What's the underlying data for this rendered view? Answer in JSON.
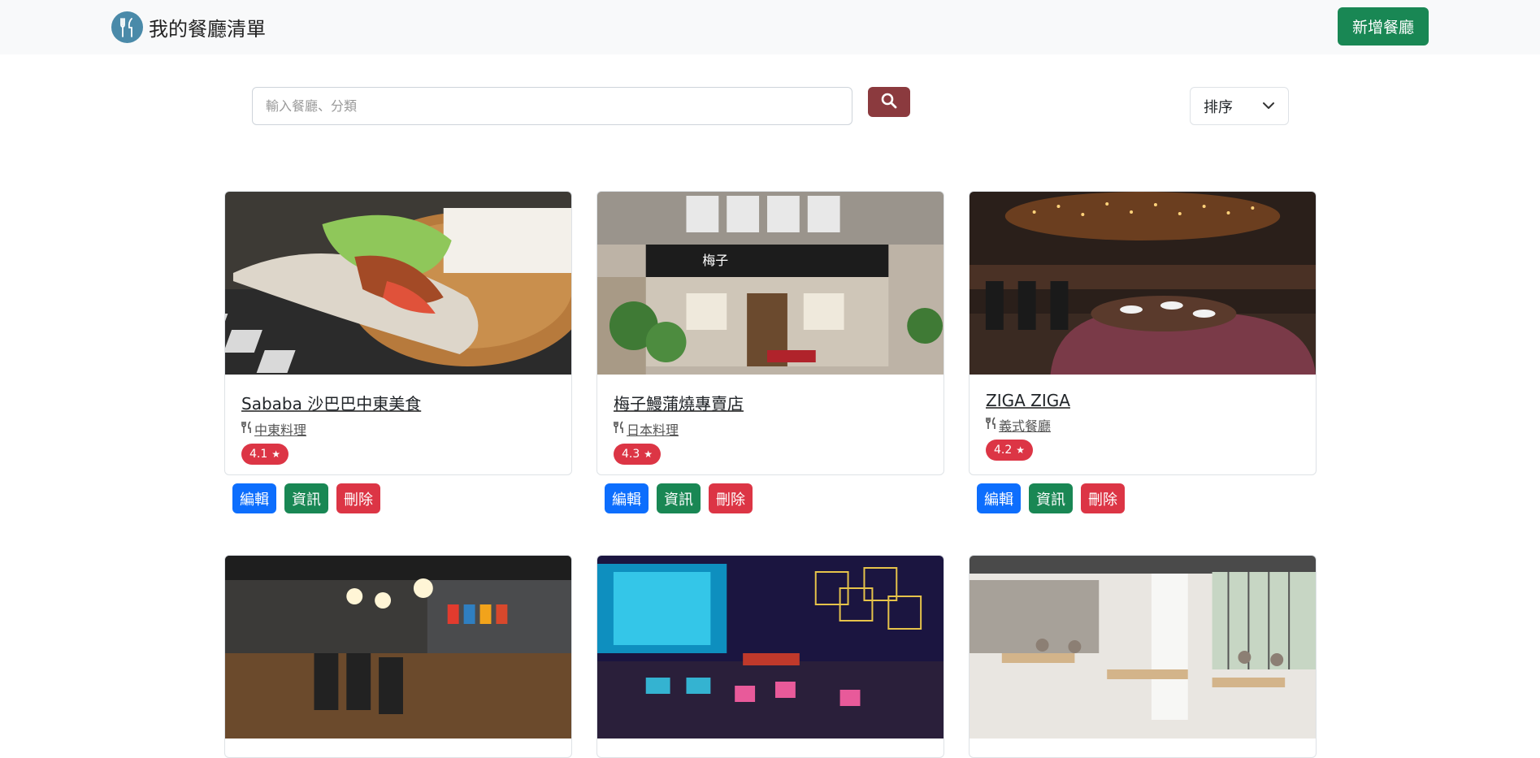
{
  "navbar": {
    "brand": "我的餐廳清單",
    "add_button": "新增餐廳"
  },
  "search": {
    "placeholder": "輸入餐廳、分類",
    "value": ""
  },
  "sort": {
    "label": "排序"
  },
  "actions": {
    "edit": "編輯",
    "info": "資訊",
    "delete": "刪除"
  },
  "restaurants": [
    {
      "name": "Sababa 沙巴巴中東美食",
      "category": "中東料理",
      "rating": "4.1"
    },
    {
      "name": "梅子鰻蒲燒專賣店",
      "category": "日本料理",
      "rating": "4.3"
    },
    {
      "name": "ZIGA ZIGA",
      "category": "義式餐廳",
      "rating": "4.2"
    }
  ],
  "colors": {
    "navbar_bg": "#f8f9fa",
    "add_button": "#198754",
    "search_button": "#8b3a3e",
    "edit": "#0d6efd",
    "info": "#198754",
    "delete": "#dc3545",
    "rating": "#dc3545"
  }
}
